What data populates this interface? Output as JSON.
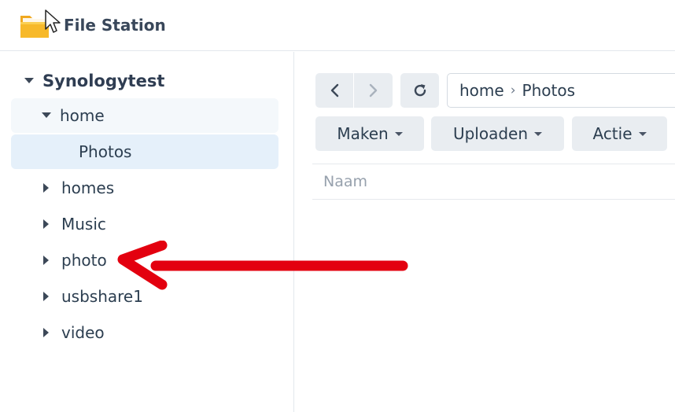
{
  "app": {
    "title": "File Station",
    "icon": "folder-icon"
  },
  "sidebar": {
    "root": {
      "label": "Synologytest",
      "expanded": true
    },
    "items": [
      {
        "label": "home",
        "expanded": true
      },
      {
        "label": "Photos",
        "selected": true
      },
      {
        "label": "homes"
      },
      {
        "label": "Music"
      },
      {
        "label": "photo"
      },
      {
        "label": "usbshare1"
      },
      {
        "label": "video"
      }
    ]
  },
  "toolbar": {
    "path": {
      "segment1": "home",
      "separator": "›",
      "segment2": "Photos"
    },
    "maken_label": "Maken",
    "uploaden_label": "Uploaden",
    "actie_label": "Actie"
  },
  "file_list": {
    "columns": [
      "Naam"
    ]
  },
  "colors": {
    "selected_bg": "#e5f0fa",
    "hover_bg": "#f4f8fb",
    "button_bg": "#e9edf1",
    "annotation_arrow": "#e3000f"
  }
}
